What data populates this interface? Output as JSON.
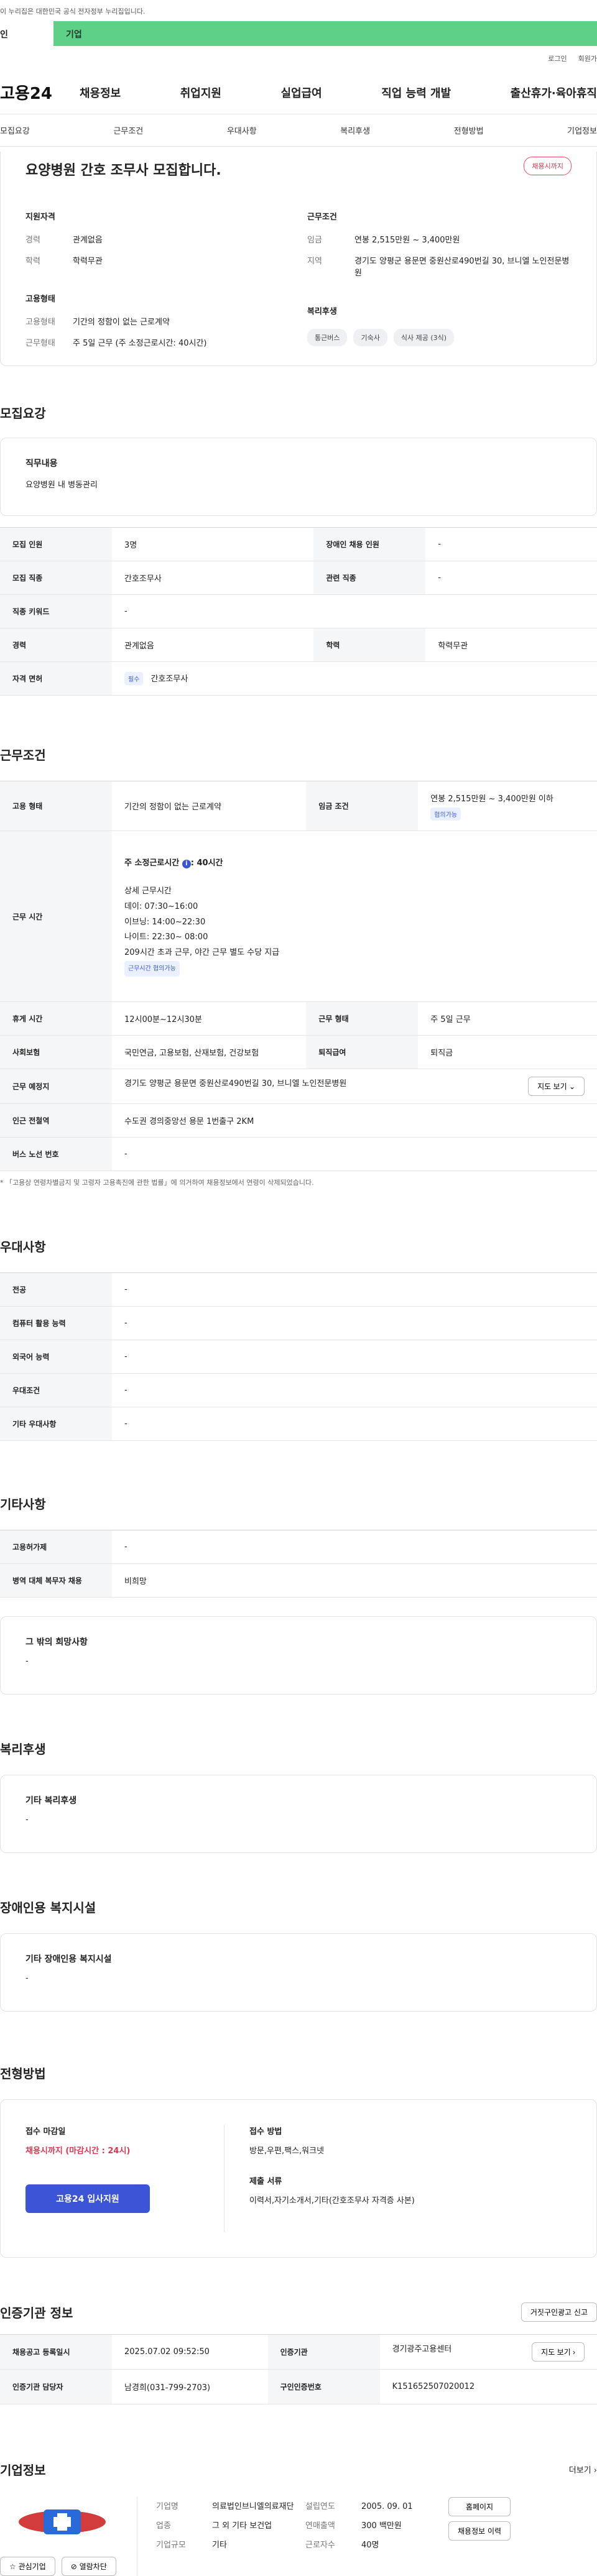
{
  "gov_banner": "이 누리집은 대한민국 공식 전자정부 누리집입니다.",
  "promo": {
    "left": "인",
    "right": "기업"
  },
  "util": [
    "로그인",
    "회원가"
  ],
  "gnb": {
    "logo": "고용24",
    "menu": [
      "채용정보",
      "취업지원",
      "실업급여",
      "직업 능력 개발",
      "출산휴가·육아휴직"
    ]
  },
  "anchor_tabs": [
    "모집요강",
    "근무조건",
    "우대사항",
    "복리후생",
    "전형방법",
    "기업정보"
  ],
  "summary": {
    "title": "요양병원 간호 조무사 모집합니다.",
    "deadline": "채용시까지",
    "qual_h": "지원자격",
    "qual": [
      {
        "k": "경력",
        "v": "관계없음"
      },
      {
        "k": "학력",
        "v": "학력무관"
      }
    ],
    "emp_h": "고용형태",
    "emp": [
      {
        "k": "고용형태",
        "v": "기간의 정함이 없는 근로계약"
      },
      {
        "k": "근무형태",
        "v": "주 5일 근무 (주 소정근로시간: 40시간)"
      }
    ],
    "cond_h": "근무조건",
    "cond": [
      {
        "k": "임금",
        "v": "연봉 2,515만원 ~ 3,400만원"
      },
      {
        "k": "지역",
        "v": "경기도 양평군 용문면 중원산로490번길 30, 브니엘 노인전문병원"
      }
    ],
    "welfare_h": "복리후생",
    "welfare_chips": [
      "통근버스",
      "기숙사",
      "식사 제공 (3식)"
    ]
  },
  "recruit": {
    "title": "모집요강",
    "duty_h": "직무내용",
    "duty": "요양병원 내 병동관리",
    "rows": [
      {
        "k1": "모집 인원",
        "v1": "3명",
        "k2": "장애인 채용 인원",
        "v2": "-"
      },
      {
        "k1": "모집 직종",
        "v1": "간호조무사",
        "k2": "관련 직종",
        "v2": "-"
      },
      {
        "k1": "직종 키워드",
        "v1": "-"
      },
      {
        "k1": "경력",
        "v1": "관계없음",
        "k2": "학력",
        "v2": "학력무관"
      }
    ],
    "license_k": "자격 면허",
    "license_tag": "필수",
    "license_v": "간호조무사"
  },
  "work": {
    "title": "근무조건",
    "emp_k": "고용 형태",
    "emp_v": "기간의 정함이 없는 근로계약",
    "wage_k": "임금 조건",
    "wage_v": "연봉 2,515만원 ~ 3,400만원 이하",
    "wage_tag": "협의가능",
    "time_k": "근무 시간",
    "time_main": "주 소정근로시간",
    "time_main_v": ": 40시간",
    "time_detail_h": "상세 근무시간",
    "time_lines": [
      "데이: 07:30~16:00",
      "이브닝: 14:00~22:30",
      "나이트: 22:30~ 08:00",
      "209시간 초과 근무, 야간 근무 별도 수당 지급"
    ],
    "time_tag": "근무시간 협의가능",
    "rest_k": "휴게 시간",
    "rest_v": "12시00분~12시30분",
    "form_k": "근무 형태",
    "form_v": "주 5일 근무",
    "ins_k": "사회보험",
    "ins_v": "국민연금, 고용보험, 산재보험, 건강보험",
    "sev_k": "퇴직급여",
    "sev_v": "퇴직금",
    "place_k": "근무 예정지",
    "place_v": "경기도 양평군 용문면 중원산로490번길 30, 브니엘 노인전문병원",
    "map_btn": "지도 보기 ⌄",
    "station_k": "인근 전철역",
    "station_v": "수도권 경의중앙선 용문 1번출구 2KM",
    "bus_k": "버스 노선 번호",
    "bus_v": "-",
    "note": "* 「고용상 연령차별금지 및 고령자 고용촉진에 관한 법률」에 의거하여 채용정보에서 연령이 삭제되었습니다."
  },
  "pref": {
    "title": "우대사항",
    "rows": [
      {
        "k": "전공",
        "v": "-"
      },
      {
        "k": "컴퓨터 활용 능력",
        "v": "-"
      },
      {
        "k": "외국어 능력",
        "v": "-"
      },
      {
        "k": "우대조건",
        "v": "-"
      },
      {
        "k": "기타 우대사항",
        "v": "-"
      }
    ]
  },
  "etc": {
    "title": "기타사항",
    "rows": [
      {
        "k": "고용허가제",
        "v": "-"
      },
      {
        "k": "병역 대체 복무자 채용",
        "v": "비희망"
      }
    ],
    "box_h": "그 밖의 희망사항",
    "box_v": "-"
  },
  "welfare": {
    "title": "복리후생",
    "box_h": "기타 복리후생",
    "box_v": "-"
  },
  "disabled": {
    "title": "장애인용 복지시설",
    "box_h": "기타 장애인용 복지시설",
    "box_v": "-"
  },
  "apply": {
    "title": "전형방법",
    "deadline_h": "접수 마감일",
    "deadline_v": "채용시까지 (마감시간 : 24시)",
    "button": "고용24 입사지원",
    "method_h": "접수 방법",
    "method_v": "방문,우편,팩스,워크넷",
    "docs_h": "제출 서류",
    "docs_v": "이력서,자기소개서,기타(간호조무사 자격증 사본)"
  },
  "cert": {
    "title": "인증기관 정보",
    "report_btn": "거짓구인광고 신고",
    "reg_k": "채용공고 등록일시",
    "reg_v": "2025.07.02 09:52:50",
    "agency_k": "인증기관",
    "agency_v": "경기광주고용센터",
    "map_btn": "지도 보기 ›",
    "staff_k": "인증기관 담당자",
    "staff_v": "남경희(031-799-2703)",
    "no_k": "구인인증번호",
    "no_v": "K151652507020012"
  },
  "company": {
    "title": "기업정보",
    "more": "더보기 ›",
    "fav_btn": "☆ 관심기업",
    "block_btn": "⊘ 열람차단",
    "fields": [
      {
        "k": "기업명",
        "v": "의료법인브니엘의료재단"
      },
      {
        "k": "업종",
        "v": "그 외 기타 보건업"
      },
      {
        "k": "기업규모",
        "v": "기타"
      }
    ],
    "fields2": [
      {
        "k": "설립연도",
        "v": "2005. 09. 01"
      },
      {
        "k": "연매출액",
        "v": "300 백만원"
      },
      {
        "k": "근로자수",
        "v": "40명"
      }
    ],
    "home_btn": "홈페이지",
    "history_btn": "채용정보 이력"
  }
}
